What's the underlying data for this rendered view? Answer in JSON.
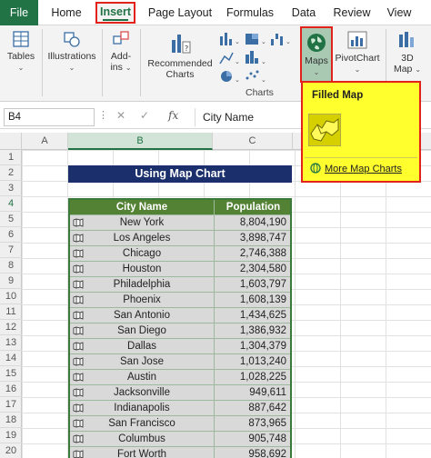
{
  "tabs": {
    "file": "File",
    "home": "Home",
    "insert": "Insert",
    "page_layout": "Page Layout",
    "formulas": "Formulas",
    "data": "Data",
    "review": "Review",
    "view": "View"
  },
  "ribbon": {
    "tables": "Tables",
    "illustrations": "Illustrations",
    "addins_line1": "Add-",
    "addins_line2": "ins",
    "recommended_line1": "Recommended",
    "recommended_line2": "Charts",
    "maps": "Maps",
    "pivotchart": "PivotChart",
    "map3d_line1": "3D",
    "map3d_line2": "Map",
    "group_charts": "Charts"
  },
  "formula_bar": {
    "name_box": "B4",
    "fx": "fx",
    "content": "City Name"
  },
  "columns": [
    "A",
    "B",
    "C"
  ],
  "rows": [
    "1",
    "2",
    "3",
    "4",
    "5",
    "6",
    "7",
    "8",
    "9",
    "10",
    "11",
    "12",
    "13",
    "14",
    "15",
    "16",
    "17",
    "18",
    "19",
    "20"
  ],
  "sheet": {
    "title": "Using Map Chart",
    "header_city": "City Name",
    "header_pop": "Population",
    "data": [
      {
        "city": "New York",
        "pop": "8,804,190"
      },
      {
        "city": "Los Angeles",
        "pop": "3,898,747"
      },
      {
        "city": "Chicago",
        "pop": "2,746,388"
      },
      {
        "city": "Houston",
        "pop": "2,304,580"
      },
      {
        "city": "Philadelphia",
        "pop": "1,603,797"
      },
      {
        "city": "Phoenix",
        "pop": "1,608,139"
      },
      {
        "city": "San Antonio",
        "pop": "1,434,625"
      },
      {
        "city": "San Diego",
        "pop": "1,386,932"
      },
      {
        "city": "Dallas",
        "pop": "1,304,379"
      },
      {
        "city": "San Jose",
        "pop": "1,013,240"
      },
      {
        "city": "Austin",
        "pop": "1,028,225"
      },
      {
        "city": "Jacksonville",
        "pop": "949,611"
      },
      {
        "city": "Indianapolis",
        "pop": "887,642"
      },
      {
        "city": "San Francisco",
        "pop": "873,965"
      },
      {
        "city": "Columbus",
        "pop": "905,748"
      },
      {
        "city": "Fort Worth",
        "pop": "958,692"
      }
    ]
  },
  "popup": {
    "title": "Filled Map",
    "more": "More Map Charts"
  },
  "colors": {
    "excel_green": "#217346",
    "highlight_red": "#e3231b",
    "popup_yellow": "#ffff2e",
    "title_navy": "#1a2f6b",
    "table_header_green": "#548235"
  }
}
